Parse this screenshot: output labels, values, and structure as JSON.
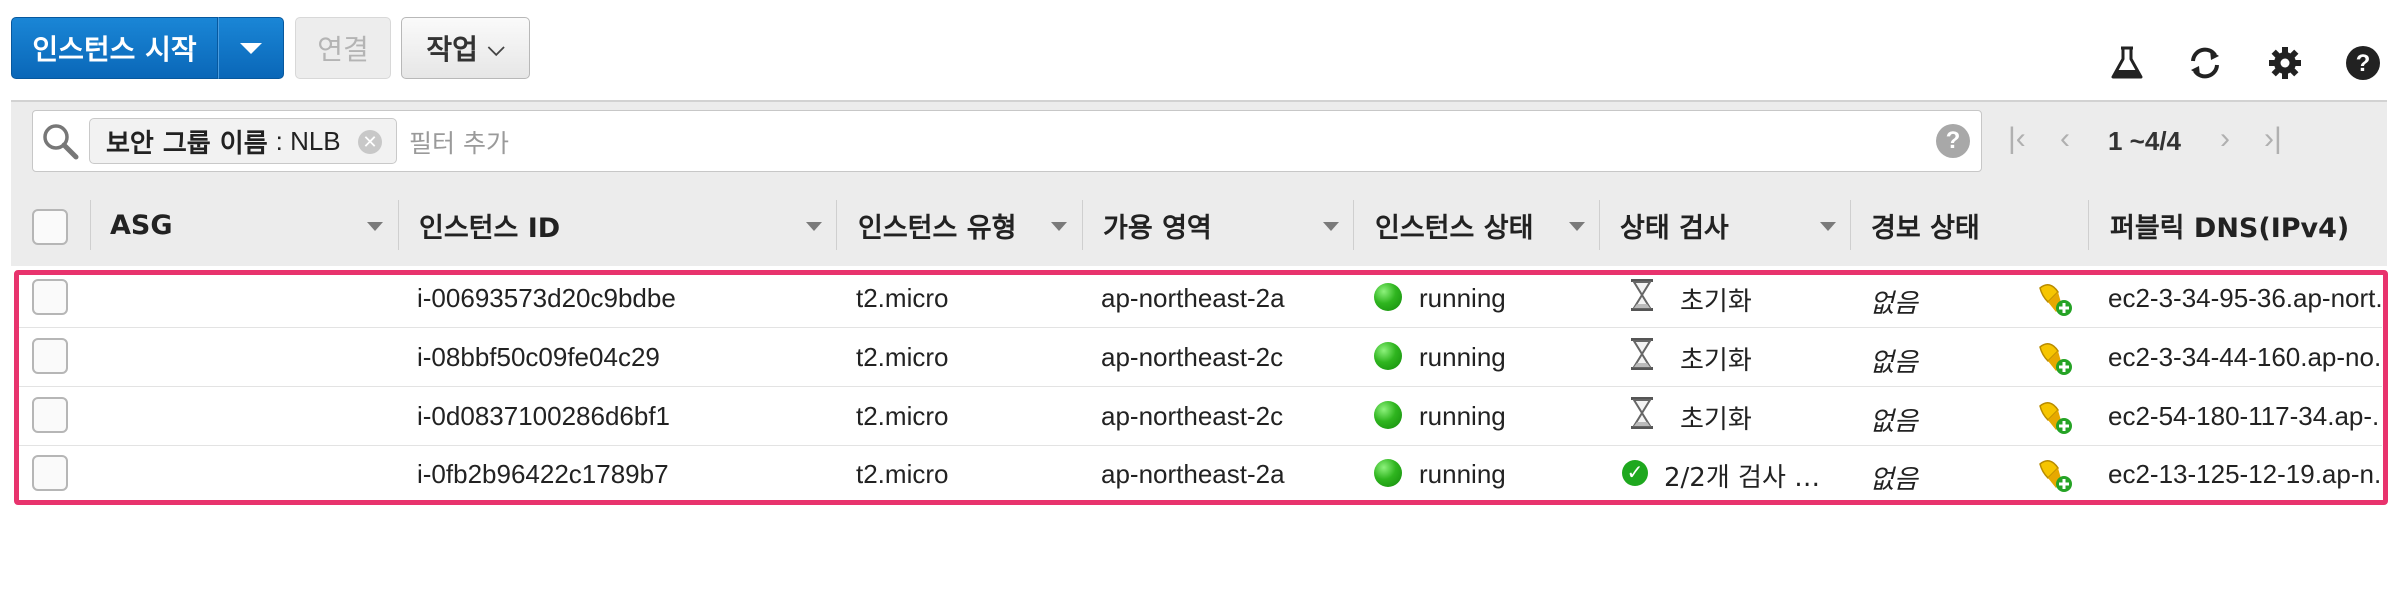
{
  "toolbar": {
    "launch_label": "인스턴스 시작",
    "connect_label": "연결",
    "actions_label": "작업"
  },
  "icons": {
    "lab": "flask-icon",
    "refresh": "refresh-icon",
    "settings": "gear-icon",
    "help": "help-icon"
  },
  "filter": {
    "tag_key": "보안 그룹 이름",
    "tag_value": ": NLB",
    "placeholder": "필터 추가"
  },
  "pagination": {
    "range": "1 ~4/4"
  },
  "columns": [
    "ASG",
    "인스턴스 ID",
    "인스턴스 유형",
    "가용 영역",
    "인스턴스 상태",
    "상태 검사",
    "경보 상태",
    "퍼블릭 DNS(IPv4)"
  ],
  "rows": [
    {
      "asg": "",
      "id": "i-00693573d20c9bdbe",
      "type": "t2.micro",
      "az": "ap-northeast-2a",
      "state": "running",
      "check": "초기화",
      "check_icon": "hourglass-icon",
      "alarm": "없음",
      "dns": "ec2-3-34-95-36.ap-nort."
    },
    {
      "asg": "",
      "id": "i-08bbf50c09fe04c29",
      "type": "t2.micro",
      "az": "ap-northeast-2c",
      "state": "running",
      "check": "초기화",
      "check_icon": "hourglass-icon",
      "alarm": "없음",
      "dns": "ec2-3-34-44-160.ap-no."
    },
    {
      "asg": "",
      "id": "i-0d0837100286d6bf1",
      "type": "t2.micro",
      "az": "ap-northeast-2c",
      "state": "running",
      "check": "초기화",
      "check_icon": "hourglass-icon",
      "alarm": "없음",
      "dns": "ec2-54-180-117-34.ap-."
    },
    {
      "asg": "",
      "id": "i-0fb2b96422c1789b7",
      "type": "t2.micro",
      "az": "ap-northeast-2a",
      "state": "running",
      "check": "2/2개 검사 …",
      "check_icon": "check-circle-icon",
      "alarm": "없음",
      "dns": "ec2-13-125-12-19.ap-n."
    }
  ],
  "colors": {
    "primary": "#0a6fc2",
    "highlight": "#e8336d",
    "running": "#2fb51f"
  }
}
